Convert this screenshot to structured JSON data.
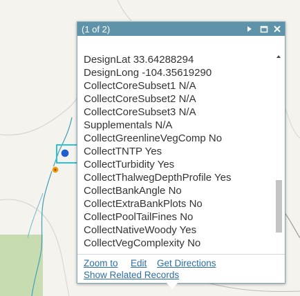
{
  "popup": {
    "title": "(1 of 2)",
    "attributes": [
      {
        "line": "DesignLat  33.64288294"
      },
      {
        "line": "DesignLong  -104.35619290"
      },
      {
        "line": "CollectCoreSubset1  N/A"
      },
      {
        "line": "CollectCoreSubset2  N/A"
      },
      {
        "line": "CollectCoreSubset3  N/A"
      },
      {
        "line": "Supplementals  N/A"
      },
      {
        "line": "CollectGreenlineVegComp  No"
      },
      {
        "line": "CollectTNTP  Yes"
      },
      {
        "line": "CollectTurbidity  Yes"
      },
      {
        "line": "CollectThalwegDepthProfile  Yes"
      },
      {
        "line": "CollectBankAngle  No"
      },
      {
        "line": "CollectExtraBankPlots  No"
      },
      {
        "line": "CollectPoolTailFines  No"
      },
      {
        "line": "CollectNativeWoody  Yes"
      },
      {
        "line": "CollectVegComplexity  No"
      }
    ],
    "actions": {
      "zoom_to": "Zoom to",
      "edit": "Edit",
      "get_directions": "Get Directions",
      "show_related": "Show Related Records"
    },
    "scroll_position": 0.82
  },
  "colors": {
    "title_bar": "#5e93a9",
    "link": "#2a6ea6",
    "selection": "#2bc4d6",
    "point_marker": "#1f5fd0",
    "other_marker": "#f39c12",
    "stream": "#4aa3b8",
    "green_area": "#c8dcb2"
  },
  "icons": [
    "next-arrow-icon",
    "maximize-icon",
    "close-icon"
  ]
}
